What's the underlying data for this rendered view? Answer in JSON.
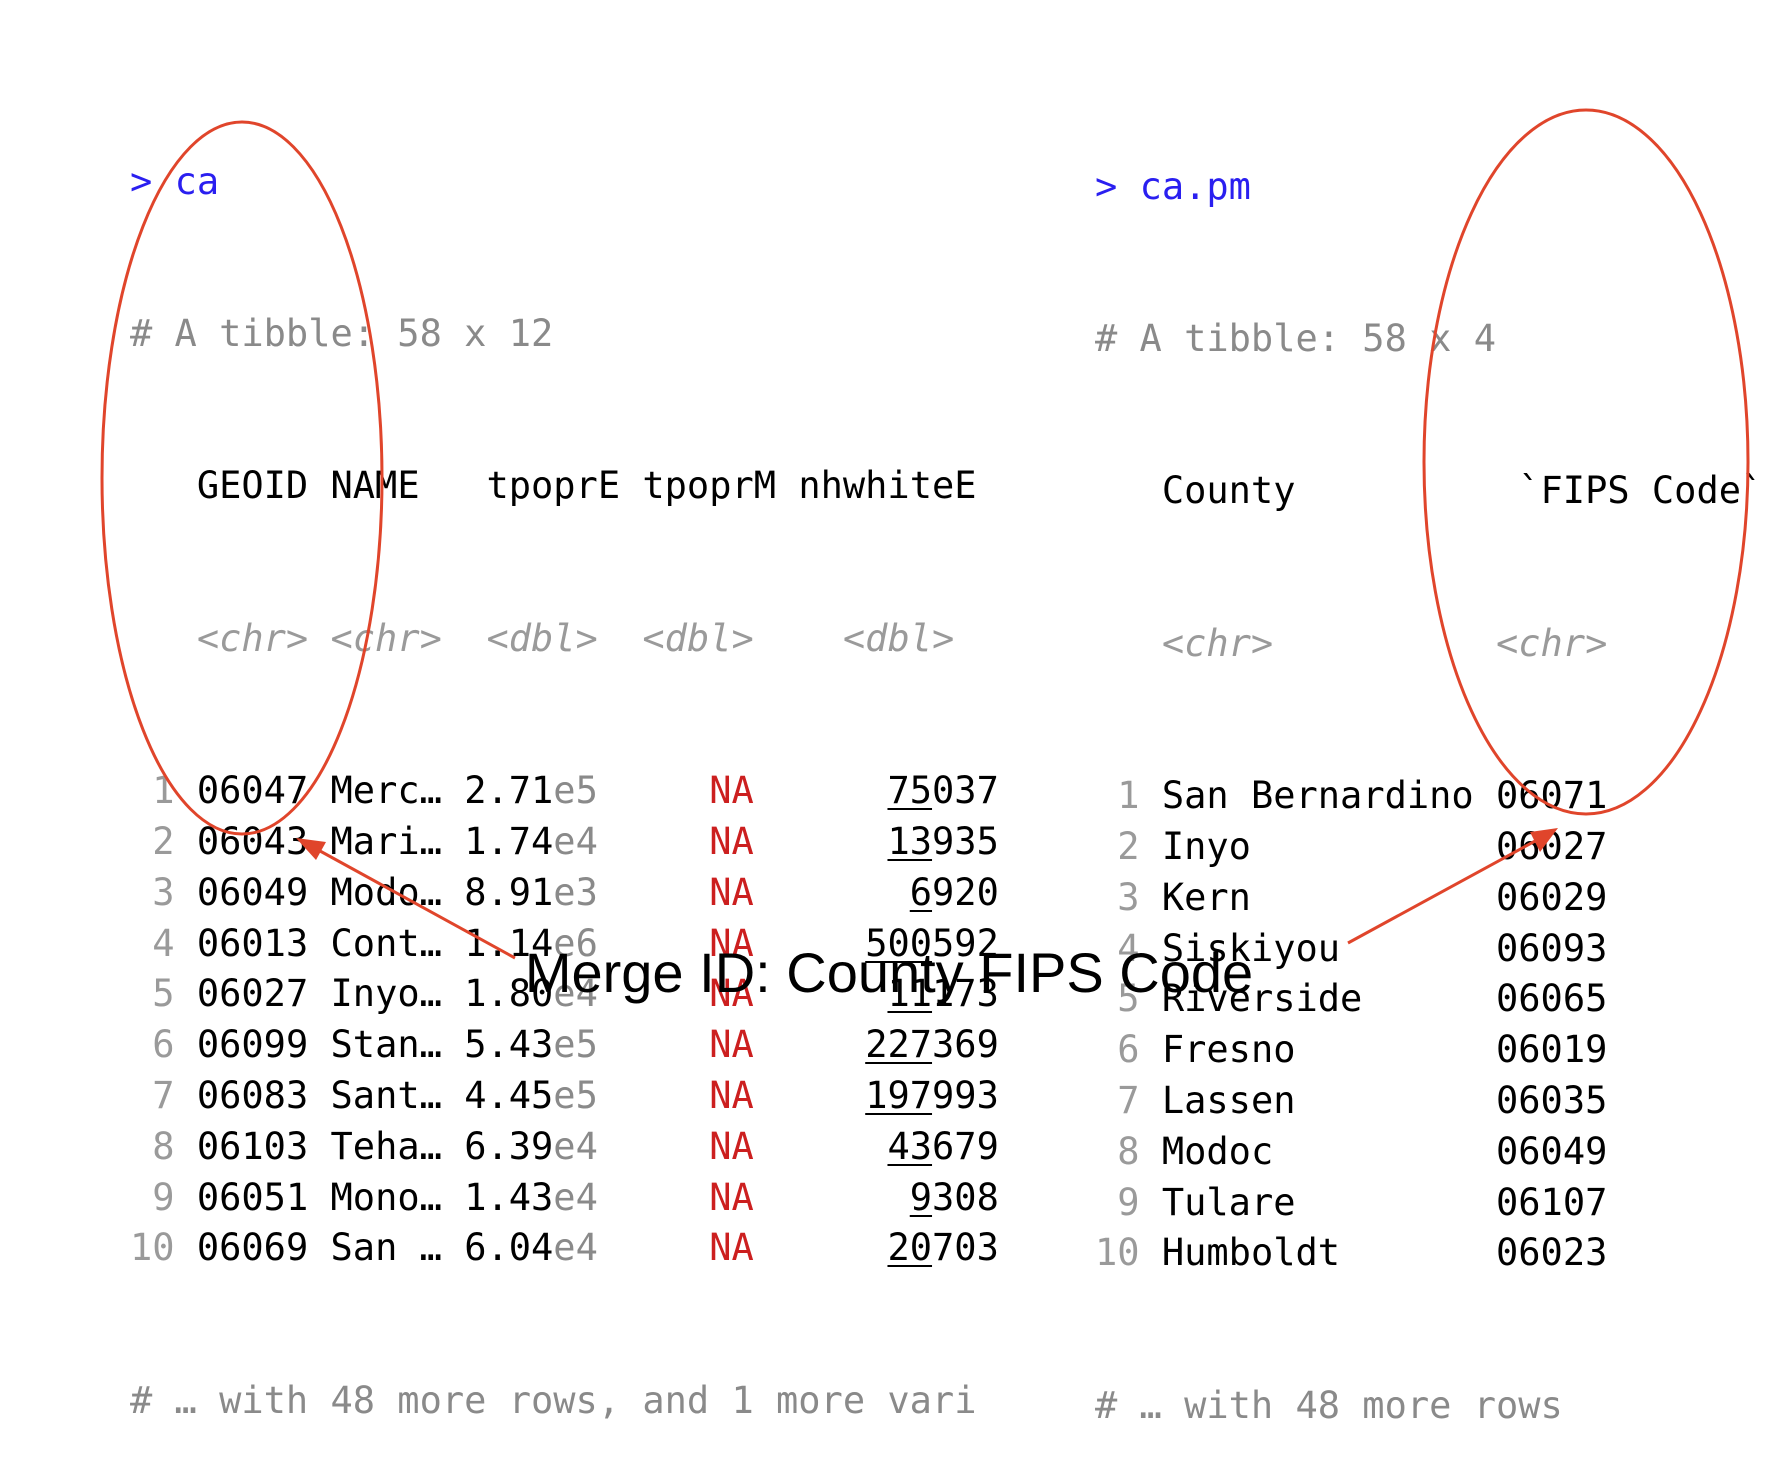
{
  "left": {
    "prompt_symbol": ">",
    "command": "ca",
    "summary": "# A tibble: 58 x 12",
    "headers": [
      "GEOID",
      "NAME",
      "tpoprE",
      "tpoprM",
      "nhwhiteE"
    ],
    "types": [
      "<chr>",
      "<chr>",
      "<dbl>",
      "<dbl>",
      "<dbl>"
    ],
    "rows": [
      {
        "num": "1",
        "geoid": "06047",
        "name": "Merc…",
        "tpopr_mant": "2.71",
        "tpopr_exp": "e5",
        "tpoprM": "NA",
        "nh_hi": "75",
        "nh_lo": "037"
      },
      {
        "num": "2",
        "geoid": "06043",
        "name": "Mari…",
        "tpopr_mant": "1.74",
        "tpopr_exp": "e4",
        "tpoprM": "NA",
        "nh_hi": "13",
        "nh_lo": "935"
      },
      {
        "num": "3",
        "geoid": "06049",
        "name": "Modo…",
        "tpopr_mant": "8.91",
        "tpopr_exp": "e3",
        "tpoprM": "NA",
        "nh_hi": "6",
        "nh_lo": "920"
      },
      {
        "num": "4",
        "geoid": "06013",
        "name": "Cont…",
        "tpopr_mant": "1.14",
        "tpopr_exp": "e6",
        "tpoprM": "NA",
        "nh_hi": "500",
        "nh_lo": "592"
      },
      {
        "num": "5",
        "geoid": "06027",
        "name": "Inyo…",
        "tpopr_mant": "1.80",
        "tpopr_exp": "e4",
        "tpoprM": "NA",
        "nh_hi": "11",
        "nh_lo": "173"
      },
      {
        "num": "6",
        "geoid": "06099",
        "name": "Stan…",
        "tpopr_mant": "5.43",
        "tpopr_exp": "e5",
        "tpoprM": "NA",
        "nh_hi": "227",
        "nh_lo": "369"
      },
      {
        "num": "7",
        "geoid": "06083",
        "name": "Sant…",
        "tpopr_mant": "4.45",
        "tpopr_exp": "e5",
        "tpoprM": "NA",
        "nh_hi": "197",
        "nh_lo": "993"
      },
      {
        "num": "8",
        "geoid": "06103",
        "name": "Teha…",
        "tpopr_mant": "6.39",
        "tpopr_exp": "e4",
        "tpoprM": "NA",
        "nh_hi": "43",
        "nh_lo": "679"
      },
      {
        "num": "9",
        "geoid": "06051",
        "name": "Mono…",
        "tpopr_mant": "1.43",
        "tpopr_exp": "e4",
        "tpoprM": "NA",
        "nh_hi": "9",
        "nh_lo": "308"
      },
      {
        "num": "10",
        "geoid": "06069",
        "name": "San …",
        "tpopr_mant": "6.04",
        "tpopr_exp": "e4",
        "tpoprM": "NA",
        "nh_hi": "20",
        "nh_lo": "703"
      }
    ],
    "footer": "# … with 48 more rows, and 1 more vari"
  },
  "right": {
    "prompt_symbol": ">",
    "command": "ca.pm",
    "summary": "# A tibble: 58 x 4",
    "headers": [
      "County",
      "`FIPS Code`"
    ],
    "types": [
      "<chr>",
      "<chr>"
    ],
    "rows": [
      {
        "num": "1",
        "county": "San Bernardino",
        "fips": "06071"
      },
      {
        "num": "2",
        "county": "Inyo",
        "fips": "06027"
      },
      {
        "num": "3",
        "county": "Kern",
        "fips": "06029"
      },
      {
        "num": "4",
        "county": "Siskiyou",
        "fips": "06093"
      },
      {
        "num": "5",
        "county": "Riverside",
        "fips": "06065"
      },
      {
        "num": "6",
        "county": "Fresno",
        "fips": "06019"
      },
      {
        "num": "7",
        "county": "Lassen",
        "fips": "06035"
      },
      {
        "num": "8",
        "county": "Modoc",
        "fips": "06049"
      },
      {
        "num": "9",
        "county": "Tulare",
        "fips": "06107"
      },
      {
        "num": "10",
        "county": "Humboldt",
        "fips": "06023"
      }
    ],
    "footer": "# … with 48 more rows"
  },
  "caption": "Merge ID: County FIPS Code",
  "colors": {
    "prompt": "#2a1ff0",
    "na": "#cc1f1f",
    "annotation": "#e0452b",
    "muted": "#8a8a8a"
  }
}
